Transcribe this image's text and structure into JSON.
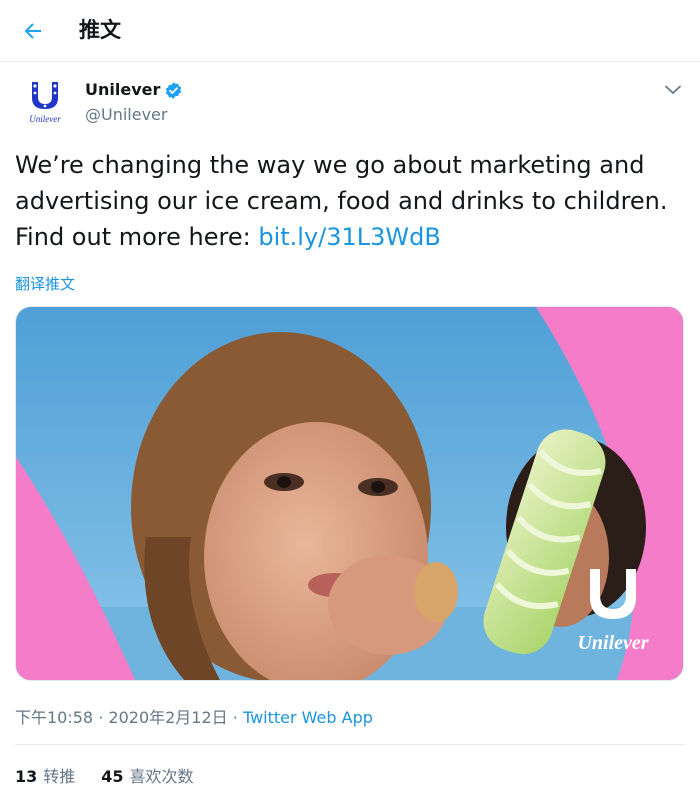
{
  "header": {
    "title": "推文",
    "back_icon": "arrow-left-icon",
    "accent": "#1da1f2"
  },
  "author": {
    "name": "Unilever",
    "handle": "@Unilever",
    "verified_icon": "verified-badge-icon",
    "avatar_text": "Unilever",
    "menu_icon": "chevron-down-icon"
  },
  "tweet": {
    "text_prefix": "We’re changing the way we go about marketing and advertising our ice cream, food and drinks to children. Find out more here: ",
    "link": "bit.ly/31L3WdB",
    "translate_label": "翻译推文"
  },
  "media": {
    "watermark": "Unilever",
    "colors": {
      "pink": "#f47cc8",
      "sky": "#5aa6d8"
    }
  },
  "meta": {
    "time": "下午10:58",
    "separator": "·",
    "date": "2020年2月12日",
    "source": "Twitter Web App"
  },
  "stats": {
    "retweets_count": "13",
    "retweets_label": "转推",
    "likes_count": "45",
    "likes_label": "喜欢次数"
  }
}
